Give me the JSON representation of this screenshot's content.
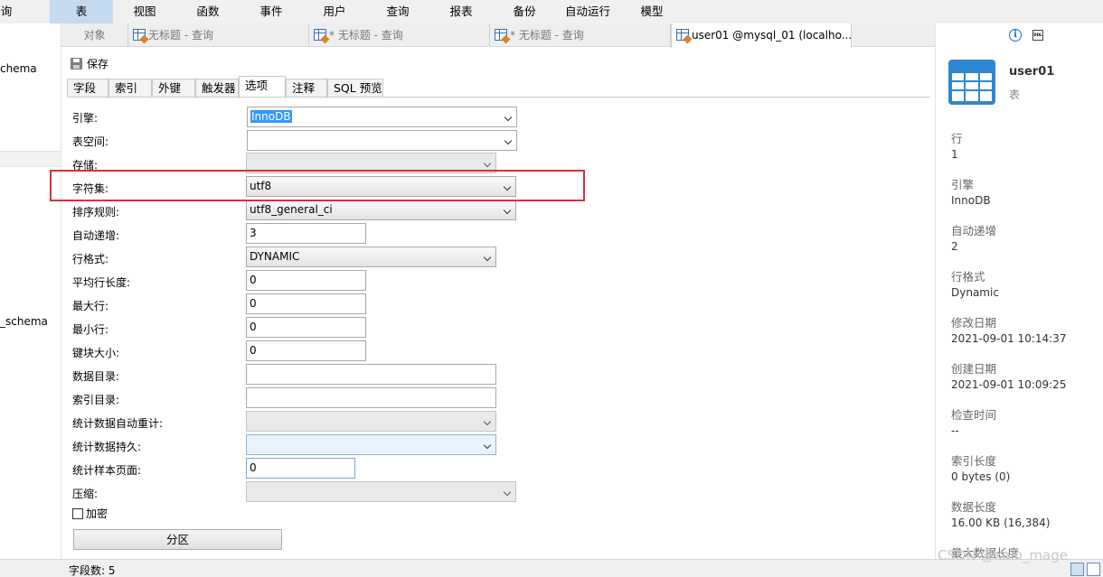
{
  "menu": {
    "items": [
      "询",
      "表",
      "视图",
      "函数",
      "事件",
      "用户",
      "查询",
      "报表",
      "备份",
      "自动运行",
      "模型"
    ],
    "active": "表"
  },
  "left_tree": {
    "items": [
      "chema",
      "_schema"
    ]
  },
  "tabs": [
    {
      "label": "对象"
    },
    {
      "label": "无标题 - 查询"
    },
    {
      "label": "* 无标题 - 查询"
    },
    {
      "label": "* 无标题 - 查询"
    },
    {
      "label": "user01 @mysql_01 (localho..."
    }
  ],
  "toolbar": {
    "save_label": "保存"
  },
  "sub_tabs": [
    "字段",
    "索引",
    "外键",
    "触发器",
    "选项",
    "注释",
    "SQL 预览"
  ],
  "form": {
    "engine": {
      "label": "引擎:",
      "value": "InnoDB"
    },
    "tablespace": {
      "label": "表空间:",
      "value": ""
    },
    "storage": {
      "label": "存储:",
      "value": ""
    },
    "charset": {
      "label": "字符集:",
      "value": "utf8"
    },
    "collation": {
      "label": "排序规则:",
      "value": "utf8_general_ci"
    },
    "auto_increment": {
      "label": "自动递增:",
      "value": "3"
    },
    "row_format": {
      "label": "行格式:",
      "value": "DYNAMIC"
    },
    "avg_row_length": {
      "label": "平均行长度:",
      "value": "0"
    },
    "max_rows": {
      "label": "最大行:",
      "value": "0"
    },
    "min_rows": {
      "label": "最小行:",
      "value": "0"
    },
    "key_block_size": {
      "label": "键块大小:",
      "value": "0"
    },
    "data_directory": {
      "label": "数据目录:",
      "value": ""
    },
    "index_directory": {
      "label": "索引目录:",
      "value": ""
    },
    "stats_auto_recalc": {
      "label": "统计数据自动重计:",
      "value": ""
    },
    "stats_persistent": {
      "label": "统计数据持久:",
      "value": ""
    },
    "stats_sample_pages": {
      "label": "统计样本页面:",
      "value": "0"
    },
    "compression": {
      "label": "压缩:",
      "value": ""
    },
    "encryption": {
      "label": "加密",
      "checked": false
    },
    "partition_button": "分区"
  },
  "info": {
    "title": "user01",
    "subtitle": "表",
    "ddl_icon_text": "DDL",
    "rows": [
      {
        "key": "行",
        "value": "1"
      },
      {
        "key": "引擎",
        "value": "InnoDB"
      },
      {
        "key": "自动递增",
        "value": "2"
      },
      {
        "key": "行格式",
        "value": "Dynamic"
      },
      {
        "key": "修改日期",
        "value": "2021-09-01 10:14:37"
      },
      {
        "key": "创建日期",
        "value": "2021-09-01 10:09:25"
      },
      {
        "key": "检查时间",
        "value": "--"
      },
      {
        "key": "索引长度",
        "value": "0 bytes (0)"
      },
      {
        "key": "数据长度",
        "value": "16.00 KB (16,384)"
      },
      {
        "key": "最大数据长度",
        "value": ""
      }
    ]
  },
  "status": {
    "field_count": "字段数: 5"
  },
  "watermark": "CSDN @xaio_mage",
  "colors": {
    "highlight_box": "#d8303a",
    "active_menu": "#c5daf1",
    "table_icon": "#2f86d2",
    "info_icon": "#1a6fc7"
  }
}
